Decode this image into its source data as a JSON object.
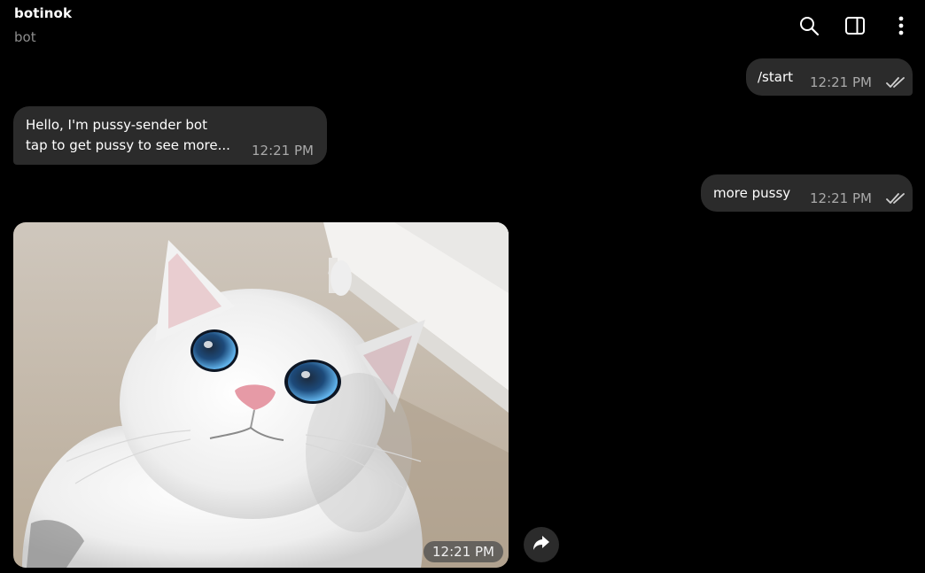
{
  "header": {
    "title": "botinok",
    "subtitle": "bot",
    "icons": [
      "search-icon",
      "side-panel-icon",
      "more-vertical-icon"
    ]
  },
  "messages": [
    {
      "direction": "outgoing",
      "text": "/start",
      "time": "12:21 PM",
      "status": "read"
    },
    {
      "direction": "incoming",
      "line1": "Hello, I'm pussy-sender bot",
      "line2": "tap to get pussy to see more...",
      "time": "12:21 PM"
    },
    {
      "direction": "outgoing",
      "text": "more pussy",
      "time": "12:21 PM",
      "status": "read"
    },
    {
      "direction": "incoming",
      "type": "photo",
      "time": "12:21 PM"
    }
  ],
  "colors": {
    "background": "#000000",
    "bubble": "#2b2b2b",
    "text": "#ffffff",
    "muted": "#a9a9a9"
  }
}
